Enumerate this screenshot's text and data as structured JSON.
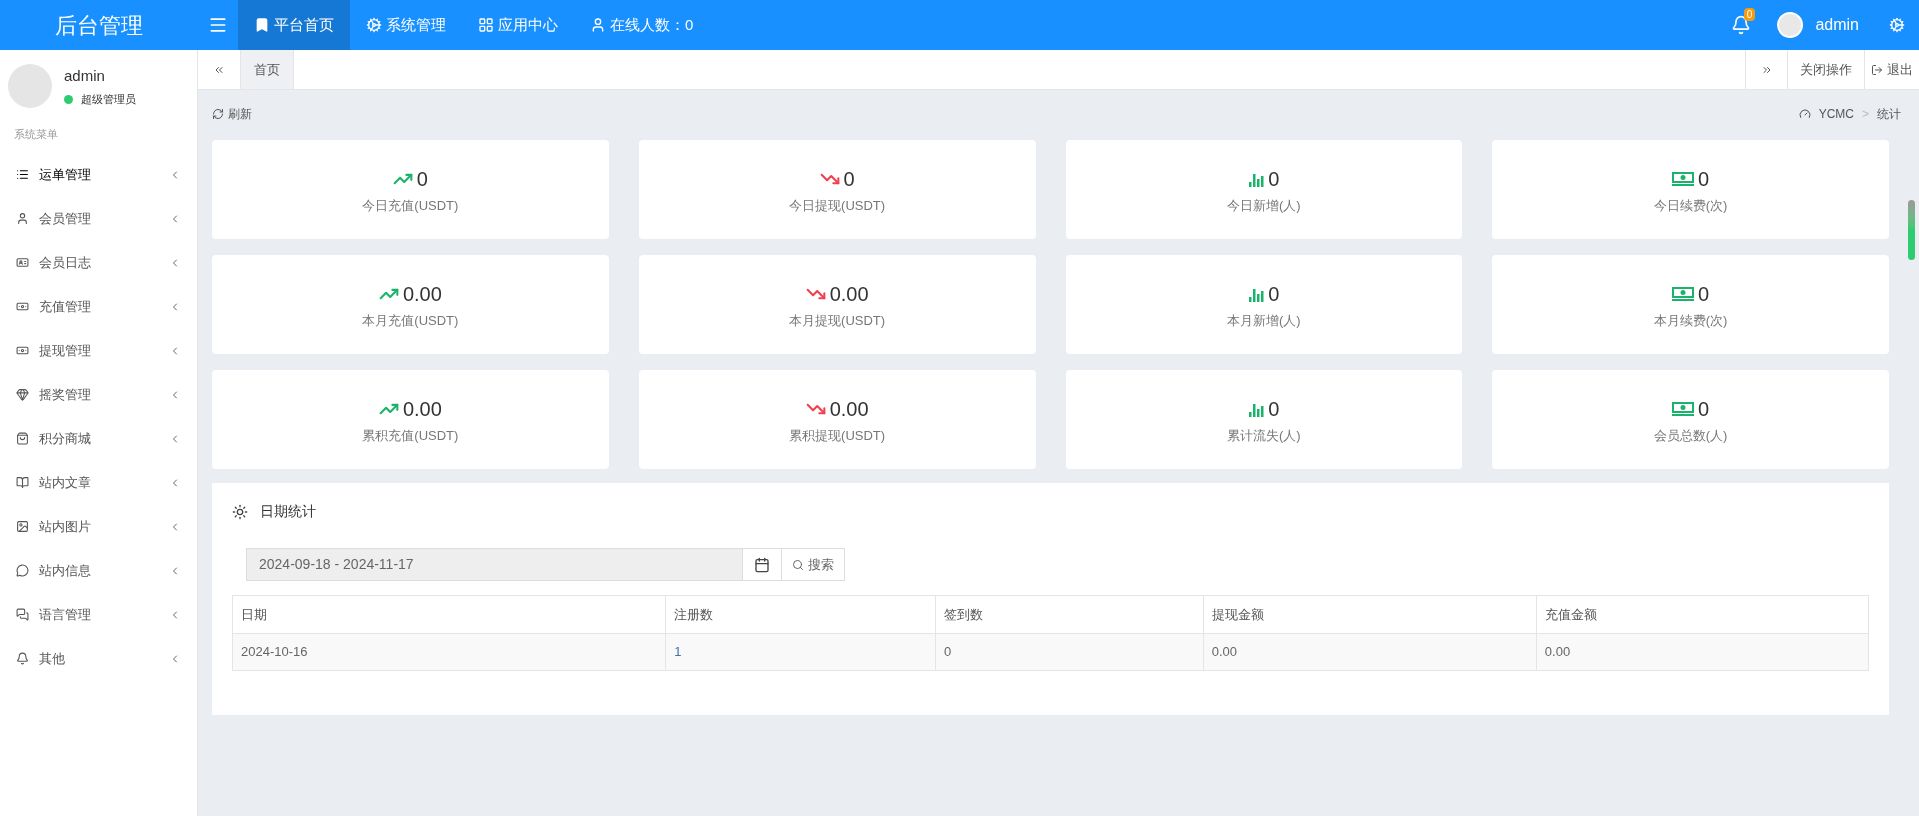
{
  "header": {
    "logo": "后台管理",
    "nav": [
      {
        "label": "平台首页",
        "selected": true,
        "kind": "bookmark"
      },
      {
        "label": "系统管理",
        "selected": false,
        "kind": "cogs"
      },
      {
        "label": "应用中心",
        "selected": false,
        "kind": "grid"
      },
      {
        "label": "在线人数：0",
        "selected": false,
        "kind": "user"
      }
    ],
    "notification_count": "0",
    "user": "admin"
  },
  "sidebar": {
    "user": {
      "name": "admin",
      "role": "超级管理员",
      "online": true
    },
    "section": "系统菜单",
    "items": [
      {
        "label": "运单管理",
        "selected": true
      },
      {
        "label": "会员管理",
        "selected": false
      },
      {
        "label": "会员日志",
        "selected": false
      },
      {
        "label": "充值管理",
        "selected": false
      },
      {
        "label": "提现管理",
        "selected": false
      },
      {
        "label": "摇奖管理",
        "selected": false
      },
      {
        "label": "积分商城",
        "selected": false
      },
      {
        "label": "站内文章",
        "selected": false
      },
      {
        "label": "站内图片",
        "selected": false
      },
      {
        "label": "站内信息",
        "selected": false
      },
      {
        "label": "语言管理",
        "selected": false
      },
      {
        "label": "其他",
        "selected": false
      }
    ]
  },
  "tabbar": {
    "tabs": [
      {
        "label": "首页",
        "selected": true
      }
    ],
    "close_label": "关闭操作",
    "logout_label": "退出"
  },
  "toolbar": {
    "refresh": "刷新",
    "breadcrumb": [
      "YCMC",
      "统计"
    ],
    "breadcrumb_separator": ">"
  },
  "stats": [
    {
      "value": "0",
      "label": "今日充值(USDT)",
      "kind": "up"
    },
    {
      "value": "0",
      "label": "今日提现(USDT)",
      "kind": "down"
    },
    {
      "value": "0",
      "label": "今日新增(人)",
      "kind": "bars"
    },
    {
      "value": "0",
      "label": "今日续费(次)",
      "kind": "money"
    },
    {
      "value": "0.00",
      "label": "本月充值(USDT)",
      "kind": "up"
    },
    {
      "value": "0.00",
      "label": "本月提现(USDT)",
      "kind": "down"
    },
    {
      "value": "0",
      "label": "本月新增(人)",
      "kind": "bars"
    },
    {
      "value": "0",
      "label": "本月续费(次)",
      "kind": "money"
    },
    {
      "value": "0.00",
      "label": "累积充值(USDT)",
      "kind": "up"
    },
    {
      "value": "0.00",
      "label": "累积提现(USDT)",
      "kind": "down"
    },
    {
      "value": "0",
      "label": "累计流失(人)",
      "kind": "bars"
    },
    {
      "value": "0",
      "label": "会员总数(人)",
      "kind": "money"
    }
  ],
  "date_stats": {
    "title": "日期统计",
    "date_range": "2024-09-18 - 2024-11-17",
    "search_label": "搜索",
    "table": {
      "columns": [
        "日期",
        "注册数",
        "签到数",
        "提现金额",
        "充值金额"
      ],
      "rows": [
        [
          "2024-10-16",
          "1",
          "0",
          "0.00",
          "0.00"
        ]
      ]
    }
  }
}
